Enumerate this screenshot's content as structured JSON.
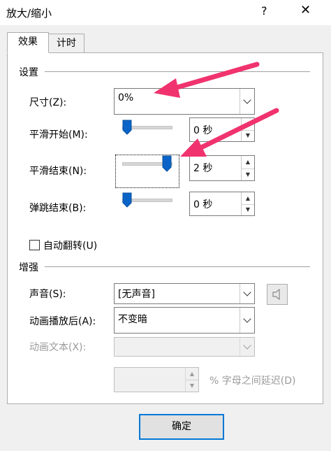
{
  "window": {
    "title": "放大/缩小",
    "help_label": "?",
    "close_label": "✕"
  },
  "tabs": [
    {
      "label": "效果",
      "active": true
    },
    {
      "label": "计时",
      "active": false
    }
  ],
  "settings": {
    "section_title": "设置",
    "size": {
      "label": "尺寸(Z):",
      "value": "0%"
    },
    "smooth_start": {
      "label": "平滑开始(M):",
      "value": "0 秒",
      "slider_fraction": 0.0
    },
    "smooth_end": {
      "label": "平滑结束(N):",
      "value": "2 秒",
      "slider_fraction": 1.0
    },
    "bounce_end": {
      "label": "弹跳结束(B):",
      "value": "0 秒",
      "slider_fraction": 0.0
    },
    "auto_reverse": {
      "label": "自动翻转(U)",
      "checked": false
    }
  },
  "enhance": {
    "section_title": "增强",
    "sound": {
      "label": "声音(S):",
      "value": "[无声音]"
    },
    "after_animation": {
      "label": "动画播放后(A):",
      "value": "不变暗"
    },
    "animate_text": {
      "label": "动画文本(X):",
      "value": ""
    },
    "letter_delay": {
      "value": "",
      "suffix": "% 字母之间延迟(D)"
    }
  },
  "ok_label": "确定",
  "colors": {
    "slider_thumb": "#0a64c8",
    "annotation_arrow": "#f0336e",
    "accent": "#0078d7"
  }
}
